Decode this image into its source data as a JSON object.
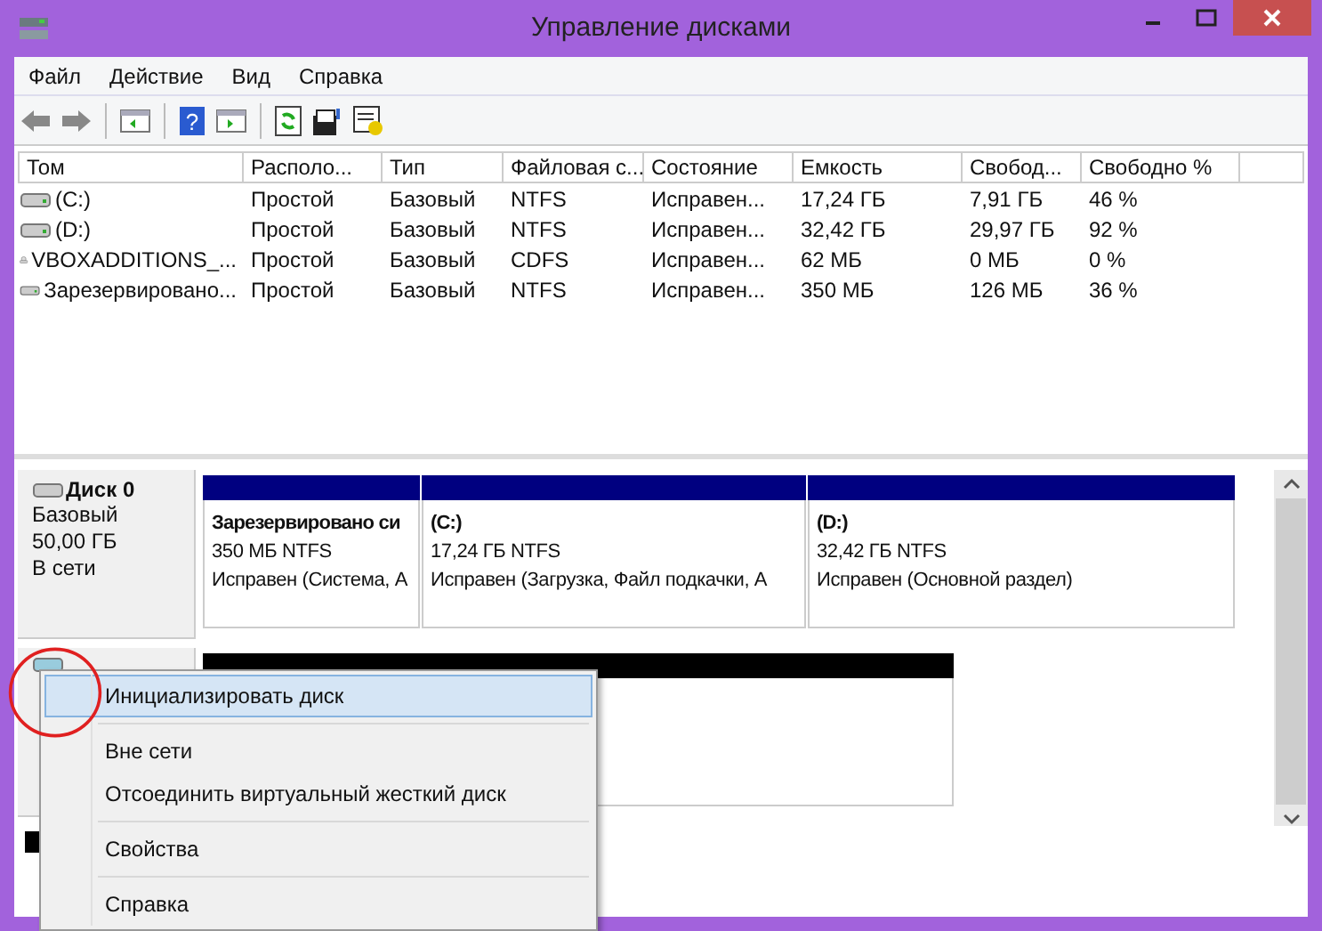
{
  "window": {
    "title": "Управление дисками"
  },
  "menu": [
    "Файл",
    "Действие",
    "Вид",
    "Справка"
  ],
  "toolbar": {
    "help_glyph": "?"
  },
  "volumes": {
    "columns": [
      "Том",
      "Располо...",
      "Тип",
      "Файловая с...",
      "Состояние",
      "Емкость",
      "Свобод...",
      "Свободно %"
    ],
    "rows": [
      {
        "kind": "disk",
        "cells": [
          "(C:)",
          "Простой",
          "Базовый",
          "NTFS",
          "Исправен...",
          "17,24 ГБ",
          "7,91 ГБ",
          "46 %"
        ]
      },
      {
        "kind": "disk",
        "cells": [
          "(D:)",
          "Простой",
          "Базовый",
          "NTFS",
          "Исправен...",
          "32,42 ГБ",
          "29,97 ГБ",
          "92 %"
        ]
      },
      {
        "kind": "cd",
        "cells": [
          "VBOXADDITIONS_...",
          "Простой",
          "Базовый",
          "CDFS",
          "Исправен...",
          "62 МБ",
          "0 МБ",
          "0 %"
        ]
      },
      {
        "kind": "disk",
        "cells": [
          "Зарезервировано...",
          "Простой",
          "Базовый",
          "NTFS",
          "Исправен...",
          "350 МБ",
          "126 МБ",
          "36 %"
        ]
      }
    ]
  },
  "disks": [
    {
      "name": "Диск 0",
      "lines": [
        "Базовый",
        "50,00 ГБ",
        "В сети"
      ],
      "partitions": [
        {
          "kind": "primary",
          "title": "Зарезервировано си",
          "size": "350 МБ NTFS",
          "status": "Исправен (Система, А"
        },
        {
          "kind": "primary",
          "title": "(C:)",
          "size": "17,24 ГБ NTFS",
          "status": "Исправен (Загрузка, Файл подкачки, А"
        },
        {
          "kind": "primary",
          "title": "(D:)",
          "size": "32,42 ГБ NTFS",
          "status": "Исправен (Основной раздел)"
        }
      ]
    },
    {
      "partitions": [
        {
          "kind": "unallocated"
        }
      ]
    }
  ],
  "context_menu": {
    "groups": [
      [
        {
          "label": "Инициализировать диск",
          "selected": true
        }
      ],
      [
        {
          "label": "Вне сети",
          "selected": false
        },
        {
          "label": "Отсоединить виртуальный жесткий диск",
          "selected": false
        }
      ],
      [
        {
          "label": "Свойства",
          "selected": false
        }
      ],
      [
        {
          "label": "Справка",
          "selected": false
        }
      ]
    ]
  }
}
